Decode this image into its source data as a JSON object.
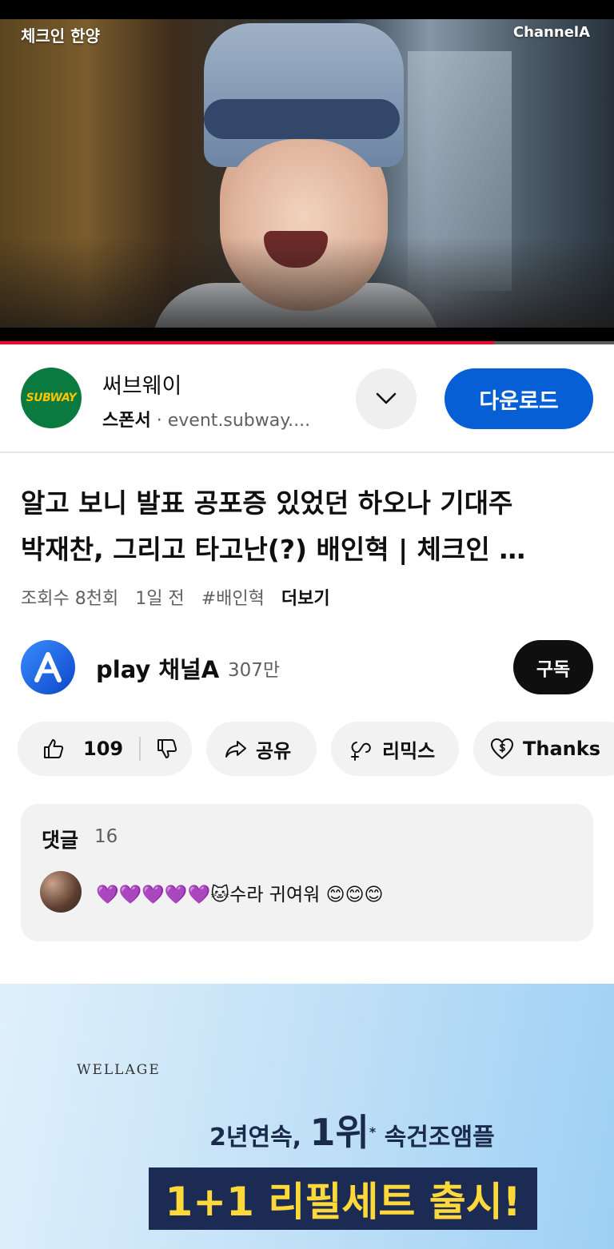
{
  "video": {
    "overlay_title": "체크인 한양",
    "overlay_brand": "ChannelA",
    "progress": 0.805
  },
  "ad": {
    "advertiser": "써브웨이",
    "logo_text": "SUBWAY",
    "sponsor_label": "스폰서",
    "url": "event.subway....",
    "cta": "다운로드"
  },
  "title": {
    "line1": "알고 보니 발표 공포증 있었던 하오나 기대주",
    "line2": "박재찬, 그리고 타고난(?) 배인혁 | 체크인 …"
  },
  "meta": {
    "views": "조회수 8천회",
    "age": "1일 전",
    "hashtag": "#배인혁",
    "more": "더보기"
  },
  "channel": {
    "name": "play 채널A",
    "subscribers": "307만",
    "subscribe_label": "구독"
  },
  "actions": {
    "likes": "109",
    "share": "공유",
    "remix": "리믹스",
    "thanks": "Thanks"
  },
  "comments": {
    "header": "댓글",
    "count": "16",
    "top_comment": "💜💜💜💜💜🐱수라 귀여워 😊😊😊"
  },
  "banner": {
    "brand": "WELLAGE",
    "line1_prefix": "2년연속,",
    "line1_highlight": "1위",
    "line1_mark": "*",
    "line1_suffix": "속건조앰플",
    "line2": "1+1 리필세트 출시!"
  },
  "colors": {
    "progress_red": "#ff0033",
    "download_blue": "#065fd4",
    "subscribe_black": "#0f0f0f",
    "subway_green": "#0a7a3e",
    "subway_yellow": "#ffc400"
  }
}
